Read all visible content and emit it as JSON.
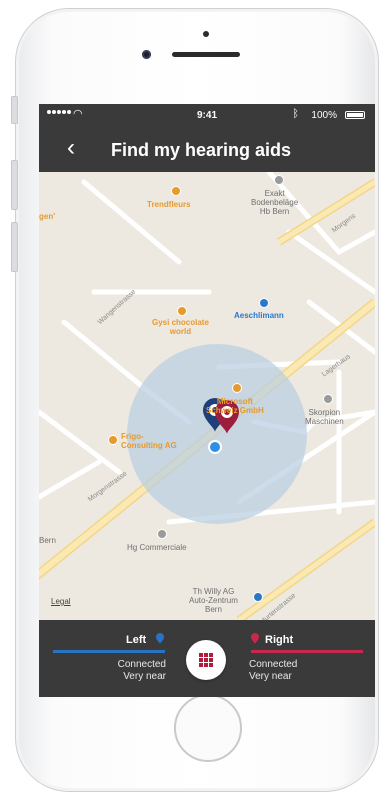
{
  "status_bar": {
    "time": "9:41",
    "battery": "100%"
  },
  "header": {
    "title": "Find my hearing aids",
    "back": "‹"
  },
  "map": {
    "labels": {
      "trendfleurs": "Trendfleurs",
      "exakt": "Exakt\nBodenbeläge\nHb Bern",
      "gysi": "Gysi chocolate\nworld",
      "aeschlimann": "Aeschlimann",
      "microsoft": "Microsoft\nSchweiz GmbH",
      "skorpion": "Skorpion\nMaschinen",
      "frigo": "Frigo-\nConsulting AG",
      "hg": "Hg Commerciale",
      "willy": "Th Willy AG\nAuto-Zentrum\nBern",
      "gen": "gen'",
      "bern": "Bern"
    },
    "streets": {
      "wangen": "Wangenstrasse",
      "morgen1": "Morgenstrasse",
      "morgen2": "Morgenstrasse",
      "murten": "Murtenstrasse",
      "lager": "Lagerhaus",
      "morgens_top": "Morgens"
    },
    "legal": "Legal"
  },
  "devices": {
    "left": {
      "label": "Left",
      "status": "Connected",
      "proximity": "Very near",
      "color": "#2a72c3"
    },
    "right": {
      "label": "Right",
      "status": "Connected",
      "proximity": "Very near",
      "color": "#c8284e"
    }
  },
  "icons": {
    "center": "grid-icon",
    "left_pin": "pin-icon",
    "right_pin": "pin-icon"
  }
}
